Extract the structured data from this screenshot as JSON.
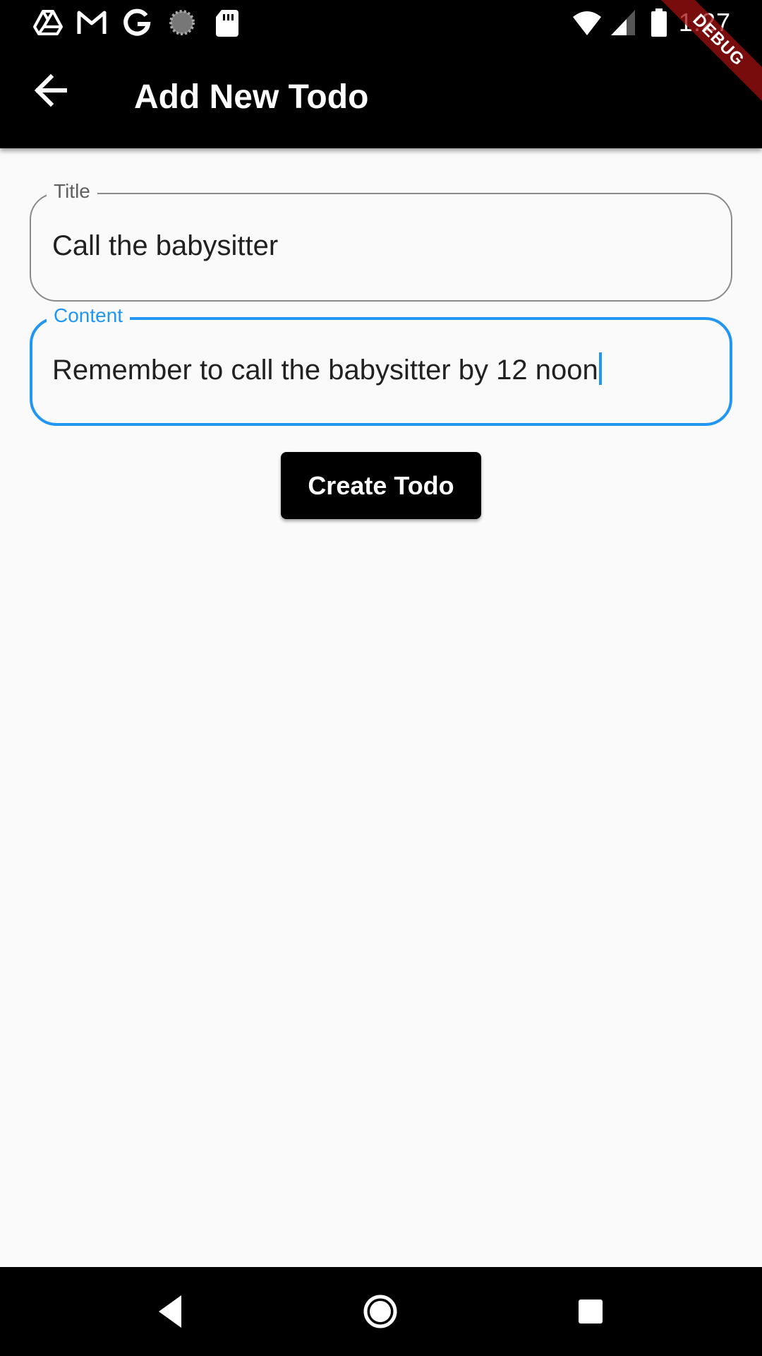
{
  "status_bar": {
    "time": "1:27",
    "left_icons": [
      "drive-icon",
      "gmail-icon",
      "google-icon",
      "sync-icon",
      "sd-card-icon"
    ],
    "right_icons": [
      "wifi-icon",
      "cell-signal-icon",
      "battery-icon"
    ]
  },
  "debug_banner": {
    "label": "DEBUG"
  },
  "app_bar": {
    "back_icon": "arrow-back-icon",
    "title": "Add New Todo"
  },
  "form": {
    "title_field": {
      "label": "Title",
      "value": "Call the babysitter",
      "focused": false
    },
    "content_field": {
      "label": "Content",
      "value": "Remember to call the babysitter by 12 noon",
      "focused": true
    },
    "submit_label": "Create Todo"
  },
  "nav_bar": {
    "buttons": [
      "back-triangle-icon",
      "home-circle-icon",
      "recents-square-icon"
    ]
  },
  "colors": {
    "app_bar": "#000000",
    "background": "#fafafa",
    "focus_accent": "#2196f3",
    "outline": "#8a8a8a",
    "button": "#000000",
    "debug": "#a01010"
  }
}
